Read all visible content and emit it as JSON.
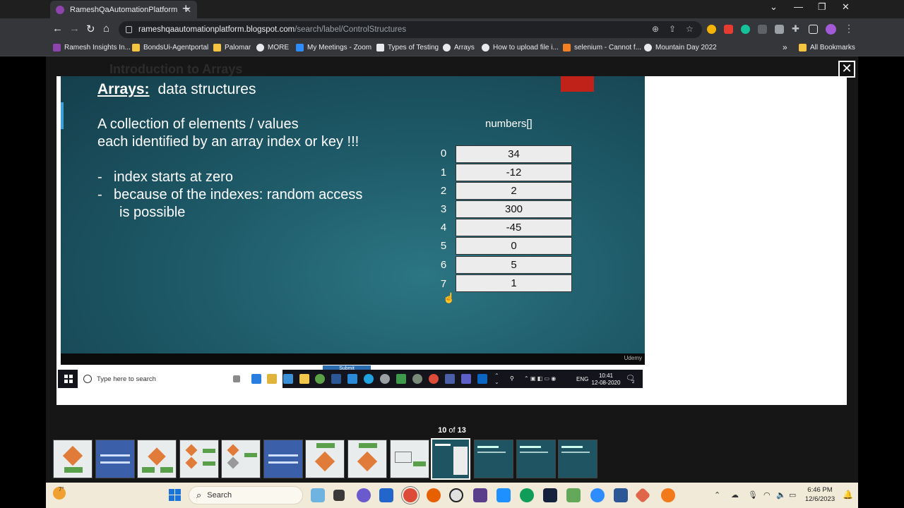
{
  "browser": {
    "tab_title": "RameshQaAutomationPlatform",
    "tab_close": "✕",
    "new_tab": "+",
    "url_host": "rameshqaautomationplatform.blogspot.com",
    "url_path": "/search/label/ControlStructures",
    "bookmarks": [
      {
        "label": "Ramesh Insights In...",
        "icon_color": "#8e44ad"
      },
      {
        "label": "BondsUi-Agentportal",
        "icon_color": "#f5c542"
      },
      {
        "label": "Palomar",
        "icon_color": "#f5c542"
      },
      {
        "label": "MORE",
        "icon_color": "#e8eaed"
      },
      {
        "label": "My Meetings - Zoom",
        "icon_color": "#2d8cff"
      },
      {
        "label": "Types of Testing",
        "icon_color": "#e8eaed"
      },
      {
        "label": "Arrays",
        "icon_color": "#e8eaed"
      },
      {
        "label": "How to upload file i...",
        "icon_color": "#e8eaed"
      },
      {
        "label": "selenium - Cannot f...",
        "icon_color": "#f48024"
      },
      {
        "label": "Mountain Day 2022",
        "icon_color": "#e8eaed"
      }
    ],
    "bookmarks_overflow": "»",
    "all_bookmarks": "All Bookmarks"
  },
  "page": {
    "background_heading": "Introduction to Arrays",
    "lightbox_close": "✕"
  },
  "slide": {
    "title_bold": "Arrays:",
    "title_rest": "data structures",
    "line1": "A collection of elements / values",
    "line2": "each identified by an array index or key !!!",
    "bullet_dash": "-",
    "bullet1": "index starts at zero",
    "bullet2a": "because of the indexes: random access",
    "bullet2b": "is possible",
    "array_label": "numbers[]",
    "array": [
      {
        "index": "0",
        "value": "34"
      },
      {
        "index": "1",
        "value": "-12"
      },
      {
        "index": "2",
        "value": "2"
      },
      {
        "index": "3",
        "value": "300"
      },
      {
        "index": "4",
        "value": "-45"
      },
      {
        "index": "5",
        "value": "0"
      },
      {
        "index": "6",
        "value": "5"
      },
      {
        "index": "7",
        "value": "1"
      }
    ],
    "watermark": "Udemy"
  },
  "video_taskbar": {
    "submit_label": "Submit",
    "search_placeholder": "Type here to search",
    "lang": "ENG",
    "time": "10:41",
    "date": "12-08-2020",
    "notif_count": "2"
  },
  "gallery": {
    "current": "10",
    "of_label": "of",
    "total": "13",
    "active_index": 9
  },
  "taskbar": {
    "weather_temp": "7°",
    "search_label": "Search",
    "time": "6:46 PM",
    "date": "12/6/2023"
  }
}
